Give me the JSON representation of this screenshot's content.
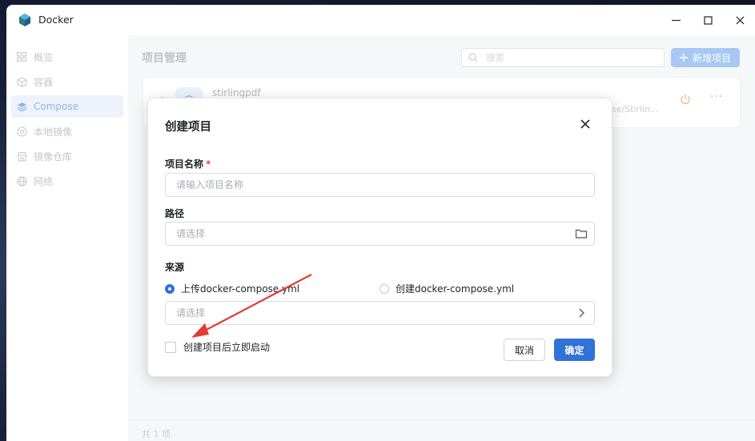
{
  "window": {
    "title": "Docker"
  },
  "sidebar": {
    "items": [
      {
        "label": "概览",
        "icon": "grid-icon"
      },
      {
        "label": "容器",
        "icon": "cube-icon"
      },
      {
        "label": "Compose",
        "icon": "layers-icon"
      },
      {
        "label": "本地镜像",
        "icon": "disc-icon"
      },
      {
        "label": "镜像仓库",
        "icon": "store-icon"
      },
      {
        "label": "网络",
        "icon": "globe-icon"
      }
    ],
    "active_index": 2
  },
  "main": {
    "title": "项目管理",
    "search_placeholder": "搜索",
    "new_button": "新增项目",
    "project": {
      "name": "stirlingpdf",
      "path": "se/Stirlin..."
    },
    "footer": "共 1 项"
  },
  "dialog": {
    "title": "创建项目",
    "name_label": "项目名称",
    "required_mark": "*",
    "name_placeholder": "请输入项目名称",
    "path_label": "路径",
    "path_placeholder": "请选择",
    "source_label": "来源",
    "source_option_upload": "上传docker-compose.yml",
    "source_option_create": "创建docker-compose.yml",
    "file_placeholder": "请选择",
    "autostart_label": "创建项目后立即启动",
    "cancel": "取消",
    "ok": "确定"
  },
  "colors": {
    "accent": "#2f72d8",
    "required": "#e5484d",
    "annotation": "#e53935"
  }
}
